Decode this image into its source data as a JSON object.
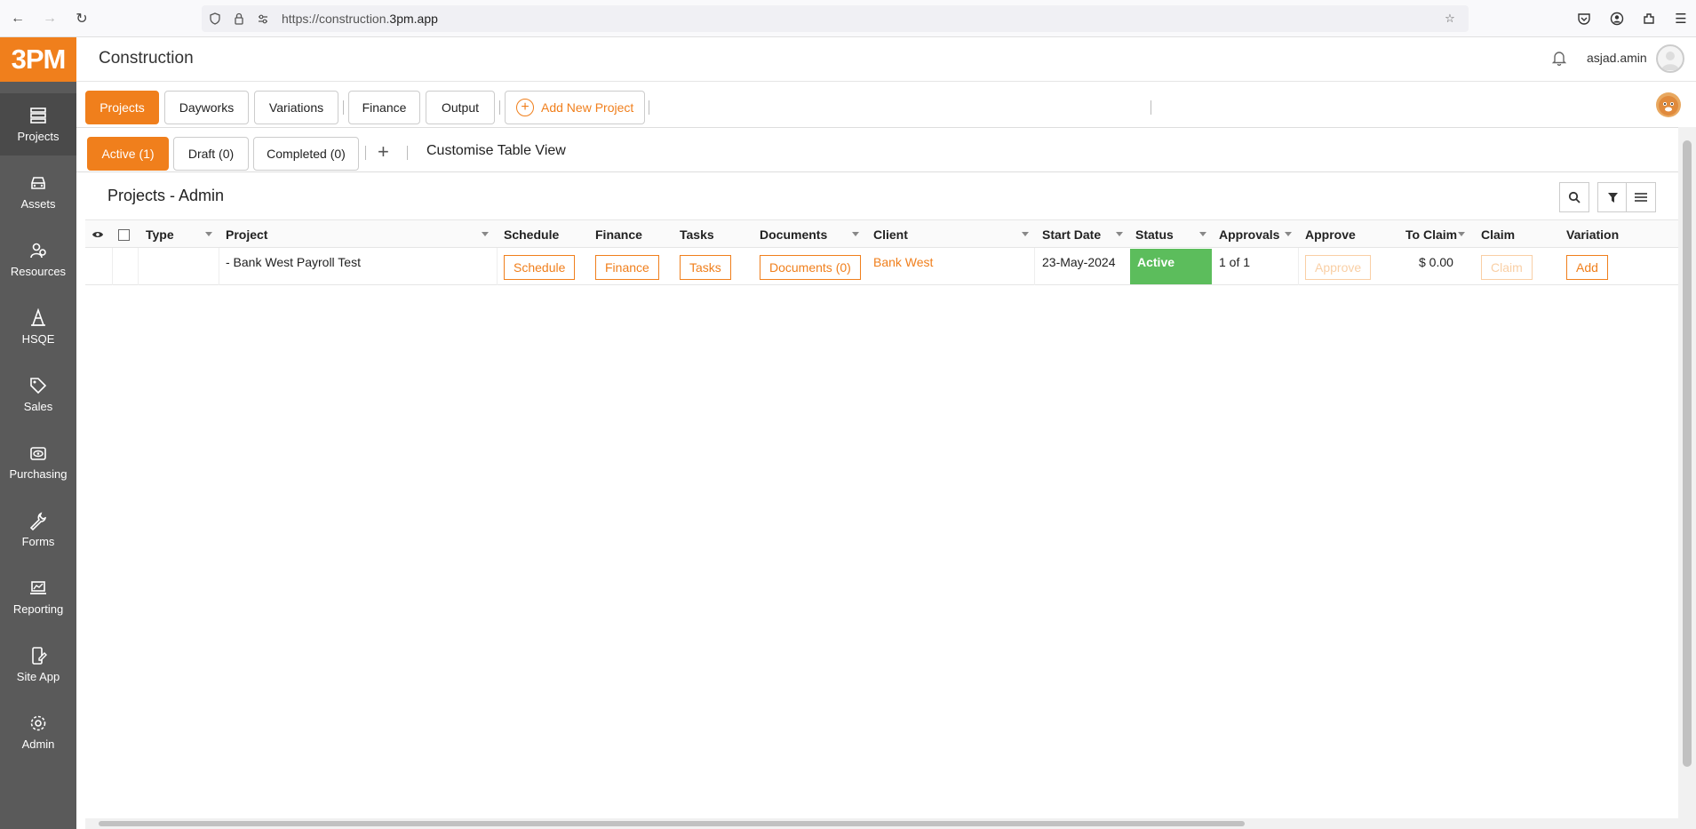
{
  "browser": {
    "url_prefix": "https://construction.",
    "url_domain": "3pm.app"
  },
  "sidebar": {
    "logo": "3PM",
    "items": [
      {
        "label": "Projects",
        "icon": "projects-icon"
      },
      {
        "label": "Assets",
        "icon": "car-icon"
      },
      {
        "label": "Resources",
        "icon": "people-icon"
      },
      {
        "label": "HSQE",
        "icon": "cone-icon"
      },
      {
        "label": "Sales",
        "icon": "tag-icon"
      },
      {
        "label": "Purchasing",
        "icon": "eye-money-icon"
      },
      {
        "label": "Forms",
        "icon": "wrench-icon"
      },
      {
        "label": "Reporting",
        "icon": "laptop-chart-icon"
      },
      {
        "label": "Site App",
        "icon": "mobile-edit-icon"
      },
      {
        "label": "Admin",
        "icon": "gear-icon"
      }
    ]
  },
  "header": {
    "title": "Construction",
    "username": "asjad.amin"
  },
  "top_tabs": {
    "projects": "Projects",
    "dayworks": "Dayworks",
    "variations": "Variations",
    "finance": "Finance",
    "output": "Output",
    "add_new_project": "Add New Project"
  },
  "sub_tabs": {
    "active": "Active (1)",
    "draft": "Draft (0)",
    "completed": "Completed (0)",
    "add": "+",
    "customise": "Customise Table View"
  },
  "section": {
    "title": "Projects - Admin"
  },
  "table": {
    "headers": {
      "type": "Type",
      "project": "Project",
      "schedule": "Schedule",
      "finance": "Finance",
      "tasks": "Tasks",
      "documents": "Documents",
      "client": "Client",
      "start_date": "Start Date",
      "status": "Status",
      "approvals": "Approvals",
      "approve": "Approve",
      "to_claim": "To Claim",
      "claim": "Claim",
      "variation": "Variation"
    },
    "rows": [
      {
        "type": "",
        "project": "- Bank West Payroll Test",
        "schedule_btn": "Schedule",
        "finance_btn": "Finance",
        "tasks_btn": "Tasks",
        "documents_btn": "Documents (0)",
        "client": "Bank West",
        "start_date": "23-May-2024",
        "status": "Active",
        "approvals": "1 of 1",
        "approve_btn": "Approve",
        "to_claim": "$ 0.00",
        "claim_btn": "Claim",
        "variation_btn": "Add"
      }
    ]
  },
  "colors": {
    "accent": "#f07f1c",
    "sidebar": "#5a5a5a",
    "status_active": "#5cbd5c"
  }
}
